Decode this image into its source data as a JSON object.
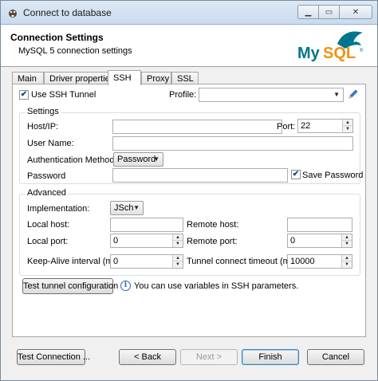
{
  "window": {
    "title": "Connect to database"
  },
  "header": {
    "title": "Connection Settings",
    "subtitle": "MySQL 5 connection settings",
    "logo_text": "MySQL"
  },
  "tabs": [
    {
      "label": "Main"
    },
    {
      "label": "Driver properties"
    },
    {
      "label": "SSH"
    },
    {
      "label": "Proxy"
    },
    {
      "label": "SSL"
    }
  ],
  "ssh": {
    "use_tunnel_label": "Use SSH Tunnel",
    "use_tunnel_checked": true,
    "profile_label": "Profile:",
    "profile_value": ""
  },
  "settings": {
    "group_title": "Settings",
    "host_label": "Host/IP:",
    "host_value": "",
    "port_label": "Port:",
    "port_value": "22",
    "user_label": "User Name:",
    "user_value": "",
    "auth_label": "Authentication Method:",
    "auth_value": "Password",
    "password_label": "Password",
    "password_value": "",
    "save_password_label": "Save Password",
    "save_password_checked": true
  },
  "advanced": {
    "group_title": "Advanced",
    "impl_label": "Implementation:",
    "impl_value": "JSch",
    "local_host_label": "Local host:",
    "local_host_value": "",
    "remote_host_label": "Remote host:",
    "remote_host_value": "",
    "local_port_label": "Local port:",
    "local_port_value": "0",
    "remote_port_label": "Remote port:",
    "remote_port_value": "0",
    "keepalive_label": "Keep-Alive interval (ms):",
    "keepalive_value": "0",
    "timeout_label": "Tunnel connect timeout (ms):",
    "timeout_value": "10000"
  },
  "test_tunnel": {
    "button_label": "Test tunnel configuration",
    "hint": "You can use variables in SSH parameters."
  },
  "footer": {
    "test_connection": "Test Connection ...",
    "back": "< Back",
    "next": "Next >",
    "finish": "Finish",
    "cancel": "Cancel"
  },
  "colors": {
    "accent": "#2a66b6",
    "logo_blue": "#00758f",
    "logo_orange": "#f29111"
  }
}
